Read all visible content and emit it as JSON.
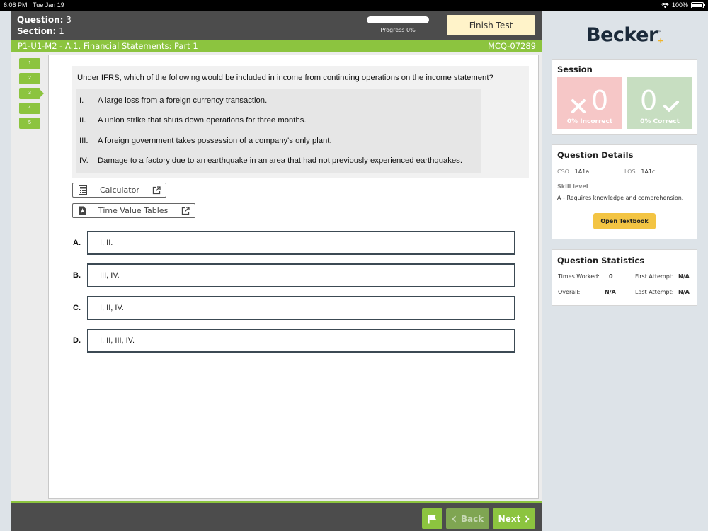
{
  "status_bar": {
    "time": "6:06 PM",
    "date": "Tue Jan 19",
    "battery": "100%"
  },
  "header": {
    "question_label": "Question:",
    "question_value": "3",
    "section_label": "Section:",
    "section_value": "1",
    "progress_text": "Progress 0%",
    "progress_fraction": 0,
    "finish_label": "Finish Test"
  },
  "unit_bar": {
    "unit": "P1-U1-M2 - A.1. Financial Statements: Part 1",
    "mcq": "MCQ-07289"
  },
  "question_nav": [
    "1",
    "2",
    "3",
    "4",
    "5"
  ],
  "question": {
    "text": "Under IFRS, which of the following would be included in income from continuing operations on the income statement?",
    "statements": [
      {
        "num": "I.",
        "text": "A large loss from a foreign currency transaction."
      },
      {
        "num": "II.",
        "text": "A union strike that shuts down operations for three months."
      },
      {
        "num": "III.",
        "text": "A foreign government takes possession of a company's only plant."
      },
      {
        "num": "IV.",
        "text": "Damage to a factory due to an earthquake in an area that had not previously experienced earthquakes."
      }
    ]
  },
  "tools": {
    "calculator": "Calculator",
    "tvt": "Time Value Tables"
  },
  "options": [
    {
      "letter": "A.",
      "text": "I, II."
    },
    {
      "letter": "B.",
      "text": "III, IV."
    },
    {
      "letter": "C.",
      "text": "I, II, IV."
    },
    {
      "letter": "D.",
      "text": "I, II, III, IV."
    }
  ],
  "footer": {
    "back_label": "Back",
    "next_label": "Next"
  },
  "brand": {
    "name": "Becker",
    "tm": "™"
  },
  "session": {
    "title": "Session",
    "incorrect_count": "0",
    "incorrect_label": "0% Incorrect",
    "correct_count": "0",
    "correct_label": "0% Correct"
  },
  "details": {
    "title": "Question Details",
    "cso_label": "CSO:",
    "cso_value": "1A1a",
    "los_label": "LOS:",
    "los_value": "1A1c",
    "skill_label": "Skill level",
    "skill_value": "A - Requires knowledge and comprehension.",
    "textbook_label": "Open Textbook"
  },
  "statistics": {
    "title": "Question Statistics",
    "times_worked_label": "Times Worked:",
    "times_worked_value": "0",
    "first_attempt_label": "First Attempt:",
    "first_attempt_value": "N/A",
    "overall_label": "Overall:",
    "overall_value": "N/A",
    "last_attempt_label": "Last Attempt:",
    "last_attempt_value": "N/A"
  },
  "colors": {
    "accent_green": "#8cc43f",
    "header_dark": "#4c4c4c",
    "finish_yellow": "#fff3c9",
    "textbook_yellow": "#f3c443"
  }
}
